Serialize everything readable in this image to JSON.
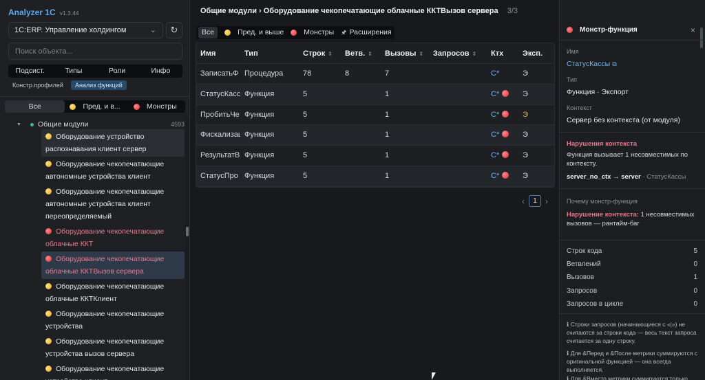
{
  "app": {
    "title": "Analyzer 1C",
    "version": "v1.3.44"
  },
  "sidebar": {
    "db_select": "1C:ERP. Управление холдингом",
    "refresh_icon": "refresh-icon",
    "search_placeholder": "Поиск объекта...",
    "nav_tabs": [
      "Подсист.",
      "Типы",
      "Роли",
      "Инфо"
    ],
    "subtabs": [
      "Констр.профилей",
      "Анализ функций"
    ],
    "filter_tabs": [
      {
        "label": "Все",
        "icon": ""
      },
      {
        "label": "Пред. и в...",
        "icon": "yellow"
      },
      {
        "label": "Монстры",
        "icon": "red"
      }
    ],
    "tree_root": {
      "label": "Общие модули",
      "count": "4593"
    },
    "tree_items": [
      {
        "label": "Оборудование устройство распознавания клиент сервер",
        "icon": "yellow",
        "state": "hl"
      },
      {
        "label": "Оборудование чекопечатающие автономные устройства клиент",
        "icon": "yellow",
        "state": ""
      },
      {
        "label": "Оборудование чекопечатающие автономные устройства клиент переопределяемый",
        "icon": "yellow",
        "state": ""
      },
      {
        "label": "Оборудование чекопечатающие облачные ККТ",
        "icon": "red",
        "state": "monster"
      },
      {
        "label": "Оборудование чекопечатающие облачные ККТВызов сервера",
        "icon": "red",
        "state": "sel monster"
      },
      {
        "label": "Оборудование чекопечатающие облачные ККТКлиент",
        "icon": "yellow",
        "state": ""
      },
      {
        "label": "Оборудование чекопечатающие устройства",
        "icon": "yellow",
        "state": ""
      },
      {
        "label": "Оборудование чекопечатающие устройства вызов сервера",
        "icon": "yellow",
        "state": ""
      },
      {
        "label": "Оборудование чекопечатающие устройства клиент",
        "icon": "yellow",
        "state": ""
      }
    ]
  },
  "main": {
    "breadcrumb": "Общие модули › Оборудование чекопечатающие облачные ККТВызов сервера",
    "pager": "3/3",
    "chips": [
      {
        "label": "Все",
        "icon": ""
      },
      {
        "label": "Пред. и выше",
        "icon": "yellow"
      },
      {
        "label": "Монстры",
        "icon": "red"
      },
      {
        "label": "Расширения",
        "icon": "ext"
      }
    ],
    "columns": [
      "Имя",
      "Тип",
      "Строк",
      "Ветв.",
      "Вызовы",
      "Запросов",
      "Ктх",
      "Эксп."
    ],
    "rows": [
      {
        "name": "ЗаписатьФ",
        "type": "Процедура",
        "lines": "78",
        "branches": "8",
        "calls": "7",
        "queries": "",
        "ctx": "С*",
        "ctx_dot": false,
        "exp": "Э",
        "exp_warn": false
      },
      {
        "name": "СтатусКасс",
        "type": "Функция",
        "lines": "5",
        "branches": "",
        "calls": "1",
        "queries": "",
        "ctx": "С*",
        "ctx_dot": true,
        "exp": "Э",
        "exp_warn": false
      },
      {
        "name": "ПробитьЧе",
        "type": "Функция",
        "lines": "5",
        "branches": "",
        "calls": "1",
        "queries": "",
        "ctx": "С*",
        "ctx_dot": true,
        "exp": "Э",
        "exp_warn": true
      },
      {
        "name": "Фискализац",
        "type": "Функция",
        "lines": "5",
        "branches": "",
        "calls": "1",
        "queries": "",
        "ctx": "С*",
        "ctx_dot": true,
        "exp": "Э",
        "exp_warn": false
      },
      {
        "name": "РезультатВ",
        "type": "Функция",
        "lines": "5",
        "branches": "",
        "calls": "1",
        "queries": "",
        "ctx": "С*",
        "ctx_dot": true,
        "exp": "Э",
        "exp_warn": false
      },
      {
        "name": "СтатусПро",
        "type": "Функция",
        "lines": "5",
        "branches": "",
        "calls": "1",
        "queries": "",
        "ctx": "С*",
        "ctx_dot": true,
        "exp": "Э",
        "exp_warn": false
      }
    ],
    "pagination": {
      "prev": "‹",
      "current": "1",
      "next": "›"
    }
  },
  "panel": {
    "title": "Монстр-функция",
    "close": "×",
    "name_label": "Имя",
    "name_value": "СтатусКассы",
    "type_label": "Тип",
    "type_value": "Функция · Экспорт",
    "context_label": "Контекст",
    "context_value": "Сервер без контекста (от модуля)",
    "violations_title": "Нарушения контекста",
    "violations_text": "Функция вызывает 1 несовместимых по контексту.",
    "arrow_from": "server_no_ctx",
    "arrow_to": "server",
    "arrow_target": "· СтатусКассы",
    "why_label": "Почему монстр-функция",
    "why_title": "Нарушение контекста:",
    "why_text": "1 несовместимых вызовов — рантайм-баг",
    "stats": [
      {
        "label": "Строк кода",
        "value": "5"
      },
      {
        "label": "Ветвлений",
        "value": "0"
      },
      {
        "label": "Вызовов",
        "value": "1"
      },
      {
        "label": "Запросов",
        "value": "0"
      },
      {
        "label": "Запросов в цикле",
        "value": "0"
      }
    ],
    "notes": [
      "ℹ Строки запросов (начинающиеся с «|») не считаются за строки кода — весь текст запроса считается за одну строку.",
      "ℹ Для &Перед и &После метрики суммируются с оригинальной функцией — она всегда выполняется.",
      "ℹ Для &Вместо метрики суммируются только"
    ]
  }
}
